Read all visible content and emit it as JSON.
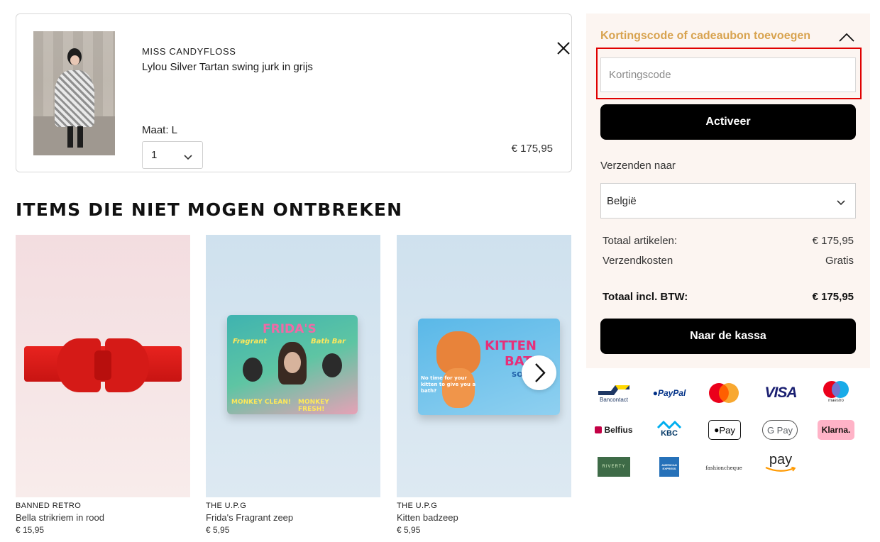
{
  "cart_item": {
    "brand": "MISS CANDYFLOSS",
    "name": "Lylou Silver Tartan swing jurk in grijs",
    "size": "Maat: L",
    "quantity": "1",
    "price": "€ 175,95"
  },
  "recommendations": {
    "title": "ITEMS DIE NIET MOGEN ONTBREKEN",
    "items": [
      {
        "brand": "BANNED RETRO",
        "name": "Bella strikriem in rood",
        "price": "€ 15,95"
      },
      {
        "brand": "THE U.P.G",
        "name": "Frida's Fragrant zeep",
        "price": "€ 5,95",
        "soap_text": [
          "FRIDA'S",
          "Fragrant",
          "Bath Bar",
          "MONKEY CLEAN!",
          "MONKEY FRESH!"
        ]
      },
      {
        "brand": "THE U.P.G",
        "name": "Kitten badzeep",
        "price": "€ 5,95",
        "soap_text": [
          "KITTEN",
          "BATH",
          "SOAP",
          "No time for your kitten to give you a bath?"
        ]
      }
    ]
  },
  "summary": {
    "discount_toggle": "Kortingscode of cadeaubon toevoegen",
    "discount_placeholder": "Kortingscode",
    "activate_label": "Activeer",
    "ship_label": "Verzenden naar",
    "country": "België",
    "rows": [
      {
        "label": "Totaal artikelen:",
        "value": "€ 175,95"
      },
      {
        "label": "Verzendkosten",
        "value": "Gratis"
      }
    ],
    "total": {
      "label": "Totaal incl. BTW:",
      "value": "€ 175,95"
    },
    "checkout_label": "Naar de kassa",
    "accent_color": "#d8a34f",
    "highlight_color": "#e00000"
  },
  "payment_methods": {
    "bancontact": "Bancontact",
    "paypal": "PayPal",
    "visa": "VISA",
    "maestro": "maestro",
    "belfius": "Belfius",
    "kbc": "KBC",
    "applepay": "Pay",
    "googlepay": "G Pay",
    "klarna": "Klarna.",
    "riverty": "RIVERTY",
    "amex": "AMERICAN EXPRESS",
    "fashioncheque": "fashioncheque",
    "amazonpay": "pay"
  }
}
